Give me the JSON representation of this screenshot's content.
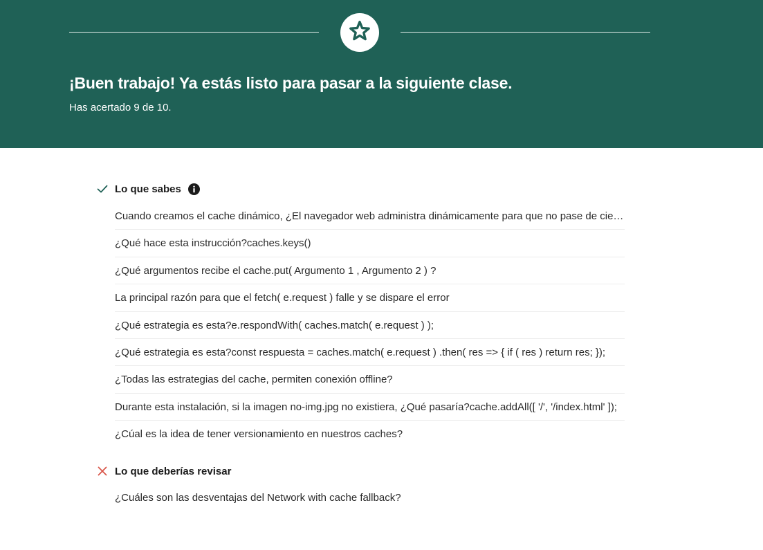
{
  "colors": {
    "hero_background": "#1f6156",
    "correct": "#1f6156",
    "incorrect": "#d9564a"
  },
  "hero": {
    "icon": "star-icon",
    "title": "¡Buen trabajo! Ya estás listo para pasar a la siguiente clase.",
    "subtitle": "Has acertado 9 de 10."
  },
  "known": {
    "status_icon": "check-icon",
    "heading": "Lo que sabes",
    "info_icon": "info-icon",
    "questions": [
      "Cuando creamos el cache dinámico, ¿El navegador web administra dinámicamente para que no pase de cierto tamaño?",
      "¿Qué hace esta instrucción?caches.keys()",
      "¿Qué argumentos recibe el cache.put(  Argumento 1 , Argumento 2 ) ?",
      "La principal razón para que el fetch( e.request ) falle y se dispare el error",
      "¿Qué estrategia es esta?e.respondWith( caches.match( e.request ) );",
      "¿Qué estrategia es esta?const respuesta = caches.match( e.request ) .then( res => { if ( res ) return res; });",
      "¿Todas las estrategias del cache, permiten conexión offline?",
      "Durante esta instalación, si la imagen no-img.jpg  no existiera, ¿Qué pasaría?cache.addAll([ '/', '/index.html' ]);",
      "¿Cúal es la idea de tener versionamiento en nuestros caches?"
    ]
  },
  "review": {
    "status_icon": "x-icon",
    "heading": "Lo que deberías revisar",
    "questions": [
      "¿Cuáles son las desventajas del Network with cache fallback?"
    ]
  }
}
